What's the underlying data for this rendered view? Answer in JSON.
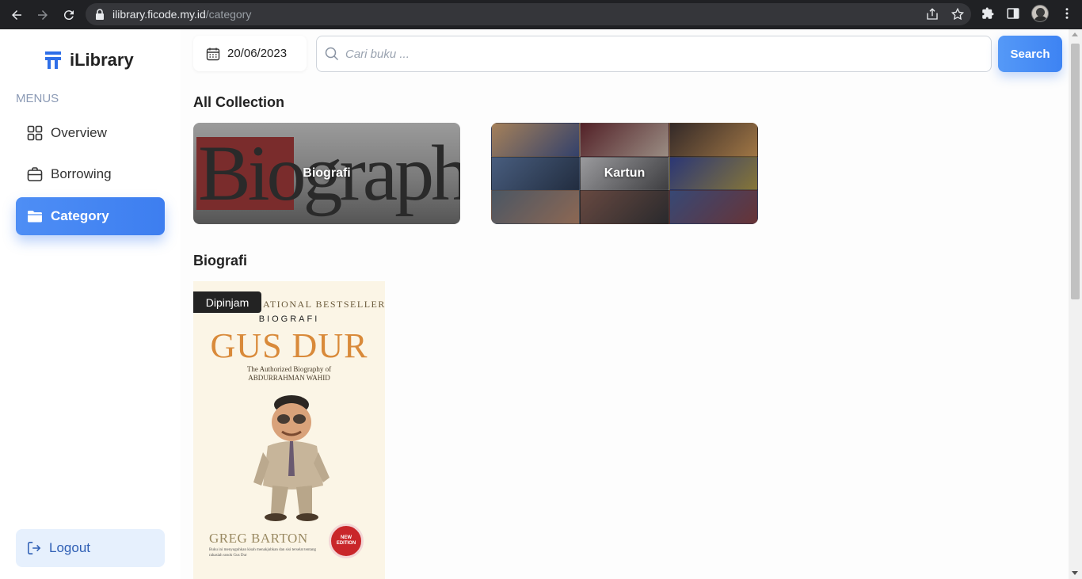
{
  "browser": {
    "url_host": "ilibrary.ficode.my.id",
    "url_path": "/category"
  },
  "sidebar": {
    "brand": "iLibrary",
    "menus_label": "MENUS",
    "items": [
      {
        "label": "Overview",
        "icon": "grid-icon"
      },
      {
        "label": "Borrowing",
        "icon": "briefcase-icon"
      },
      {
        "label": "Category",
        "icon": "folder-icon",
        "active": true
      }
    ],
    "logout_label": "Logout"
  },
  "toolbar": {
    "date": "20/06/2023",
    "search_placeholder": "Cari buku ...",
    "search_label": "Search"
  },
  "collections": {
    "title": "All Collection",
    "cards": [
      {
        "label": "Biografi",
        "cover_text": "Biography"
      },
      {
        "label": "Kartun"
      }
    ]
  },
  "section": {
    "title": "Biografi",
    "books": [
      {
        "badge": "Dipinjam",
        "cover_top": "ATIONAL BESTSELLER",
        "cover_kicker": "BIOGRAFI",
        "cover_title": "GUS DUR",
        "cover_subtitle_1": "The Authorized Biography of",
        "cover_subtitle_2": "ABDURRAHMAN WAHID",
        "cover_author": "GREG BARTON",
        "cover_blurb": "Buku ini menyuguhkan kisah menakjubkan dan sisi terselat tentang rahasiah sosok Gus Dur",
        "cover_seal": "NEW EDITION"
      }
    ]
  },
  "colors": {
    "accent": "#3d7ef0",
    "logout_bg": "#e6f0fd",
    "badge_bg": "#232323",
    "title_orange": "#d98a3a"
  }
}
